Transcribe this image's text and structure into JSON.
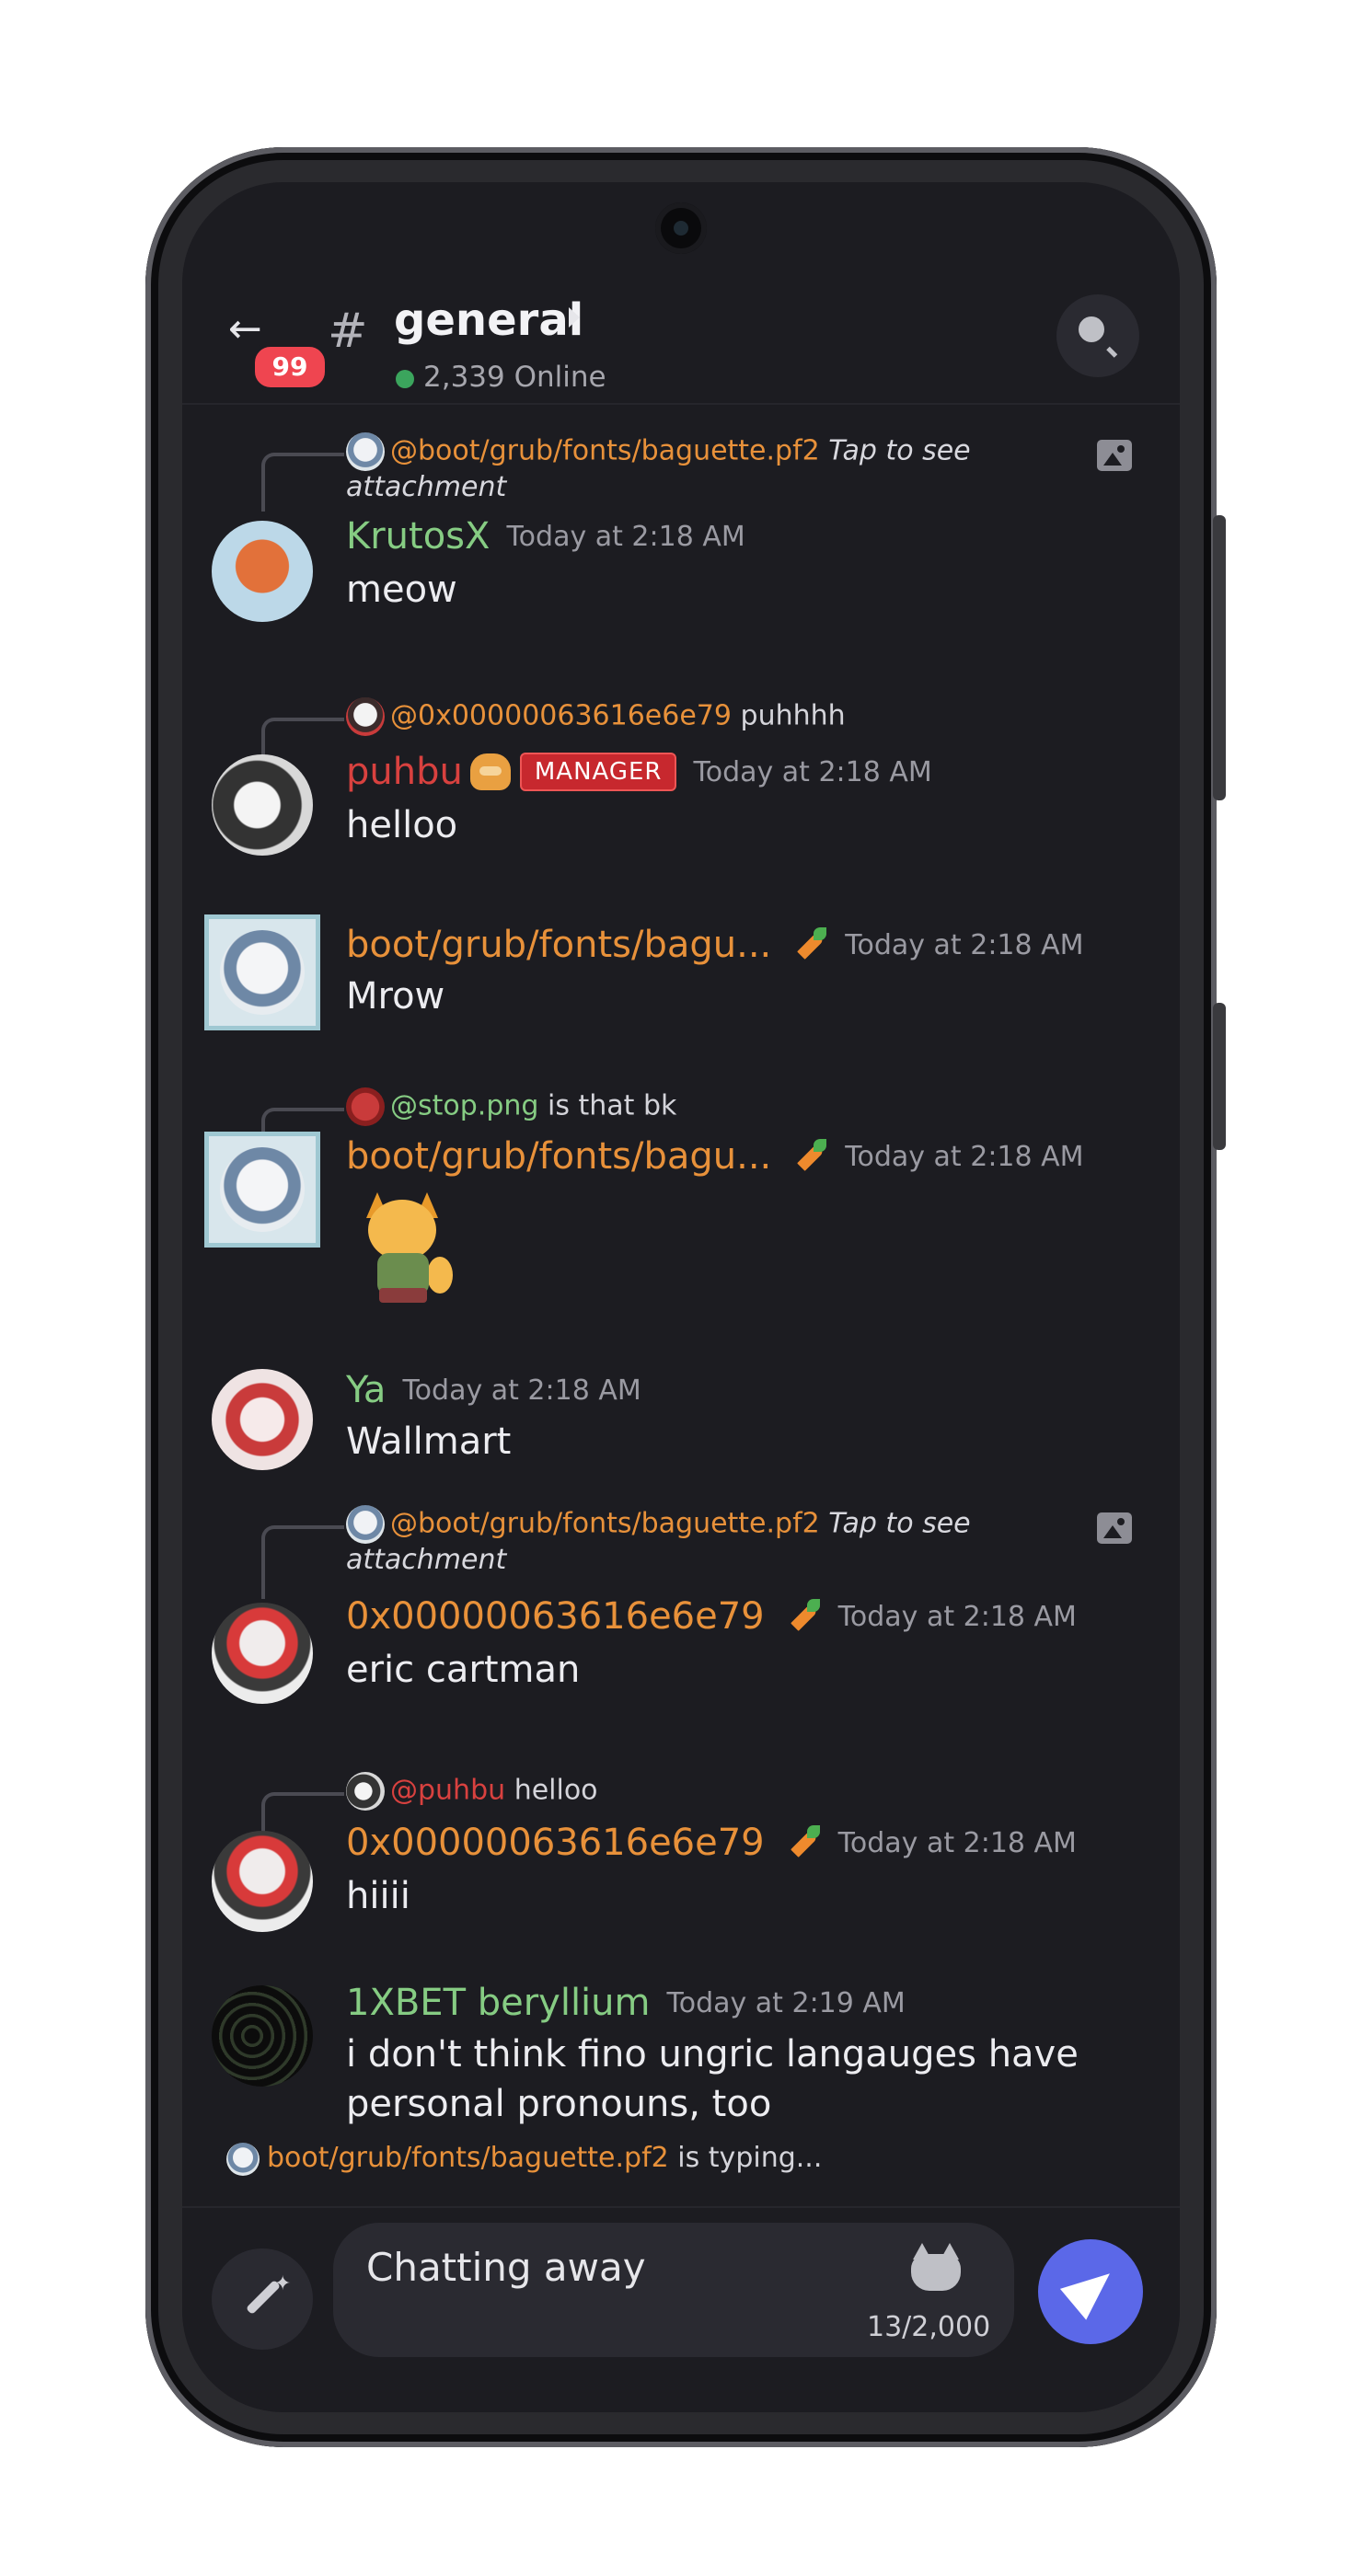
{
  "header": {
    "back_badge": "99",
    "hash": "#",
    "channel_name": "general",
    "online": "2,339 Online"
  },
  "colors": {
    "accent": "#5b68e8",
    "green_name": "#86cc83",
    "orange_name": "#e8913a",
    "red_name": "#d8413f",
    "online": "#3ba55d",
    "background": "#1c1c21"
  },
  "messages": [
    {
      "reply_author": "@boot/grub/fonts/baguette.pf2",
      "reply_text_a": "Tap to see",
      "reply_text_b": "attachment",
      "author": "KrutosX",
      "time": "Today at 2:18 AM",
      "text": "meow"
    },
    {
      "reply_author": "@0x00000063616e6e79",
      "reply_text": "puhhhh",
      "author": "puhbu",
      "role": "MANAGER",
      "time": "Today at 2:18 AM",
      "text": "helloo"
    },
    {
      "author": "boot/grub/fonts/bagu...",
      "time": "Today at 2:18 AM",
      "text": "Mrow"
    },
    {
      "reply_author": "@stop.png",
      "reply_text": "is that bk",
      "author": "boot/grub/fonts/bagu...",
      "time": "Today at 2:18 AM"
    },
    {
      "author": "Ya",
      "time": "Today at 2:18 AM",
      "text": "Wallmart"
    },
    {
      "reply_author": "@boot/grub/fonts/baguette.pf2",
      "reply_text_a": "Tap to see",
      "reply_text_b": "attachment",
      "author": "0x00000063616e6e79",
      "time": "Today at 2:18 AM",
      "text": "eric cartman"
    },
    {
      "reply_author": "@puhbu",
      "reply_text": "helloo",
      "author": "0x00000063616e6e79",
      "time": "Today at 2:18 AM",
      "text": "hiiii"
    },
    {
      "author": "1XBET beryllium",
      "time": "Today at 2:19 AM",
      "text_line1": "i don't think fino ungric langauges have",
      "text_line2": "personal pronouns, too"
    }
  ],
  "typing": {
    "user": "boot/grub/fonts/baguette.pf2",
    "suffix": "is typing..."
  },
  "composer": {
    "value": "Chatting away",
    "count": "13/2,000"
  }
}
